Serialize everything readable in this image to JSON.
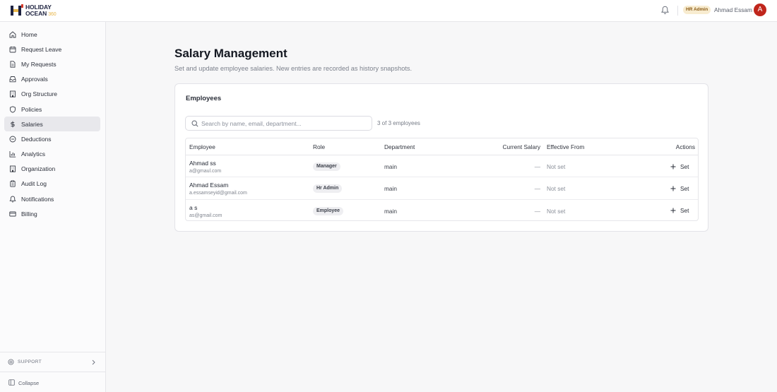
{
  "header": {
    "logo": {
      "line1": "HOLIDAY",
      "line2": "OCEAN",
      "suffix": "360"
    },
    "role_badge": "HR Admin",
    "user_name": "Ahmad Essam",
    "avatar_initial": "A"
  },
  "sidebar": {
    "items": [
      {
        "label": "Home",
        "icon": "home-icon"
      },
      {
        "label": "Request Leave",
        "icon": "calendar-icon"
      },
      {
        "label": "My Requests",
        "icon": "document-icon"
      },
      {
        "label": "Approvals",
        "icon": "inbox-icon"
      },
      {
        "label": "Org Structure",
        "icon": "building-icon"
      },
      {
        "label": "Policies",
        "icon": "shield-icon"
      },
      {
        "label": "Salaries",
        "icon": "dollar-icon",
        "active": true
      },
      {
        "label": "Deductions",
        "icon": "minus-circle-icon"
      },
      {
        "label": "Analytics",
        "icon": "bar-chart-icon"
      },
      {
        "label": "Organization",
        "icon": "building-icon"
      },
      {
        "label": "Audit Log",
        "icon": "clipboard-icon"
      },
      {
        "label": "Notifications",
        "icon": "bell-icon"
      },
      {
        "label": "Billing",
        "icon": "credit-card-icon"
      }
    ],
    "support_label": "SUPPORT",
    "collapse_label": "Collapse"
  },
  "main": {
    "title": "Salary Management",
    "subtitle": "Set and update employee salaries. New entries are recorded as history snapshots.",
    "card": {
      "title": "Employees",
      "search_placeholder": "Search by name, email, department...",
      "count_text": "3 of 3 employees",
      "columns": [
        "Employee",
        "Role",
        "Department",
        "Current Salary",
        "Effective From",
        "Actions"
      ],
      "rows": [
        {
          "name": "Ahmad ss",
          "email": "a@gmaul.com",
          "role": "Manager",
          "department": "main",
          "salary": "—",
          "effective_from": "Not set",
          "action": "Set"
        },
        {
          "name": "Ahmad Essam",
          "email": "a.essamseyid@gmail.com",
          "role": "Hr Admin",
          "department": "main",
          "salary": "—",
          "effective_from": "Not set",
          "action": "Set"
        },
        {
          "name": "a s",
          "email": "as@gmail.com",
          "role": "Employee",
          "department": "main",
          "salary": "—",
          "effective_from": "Not set",
          "action": "Set"
        }
      ]
    }
  },
  "colors": {
    "accent_avatar": "#c0261c",
    "badge_bg": "#f8ecd0",
    "active_nav_bg": "#e8e8ec"
  }
}
